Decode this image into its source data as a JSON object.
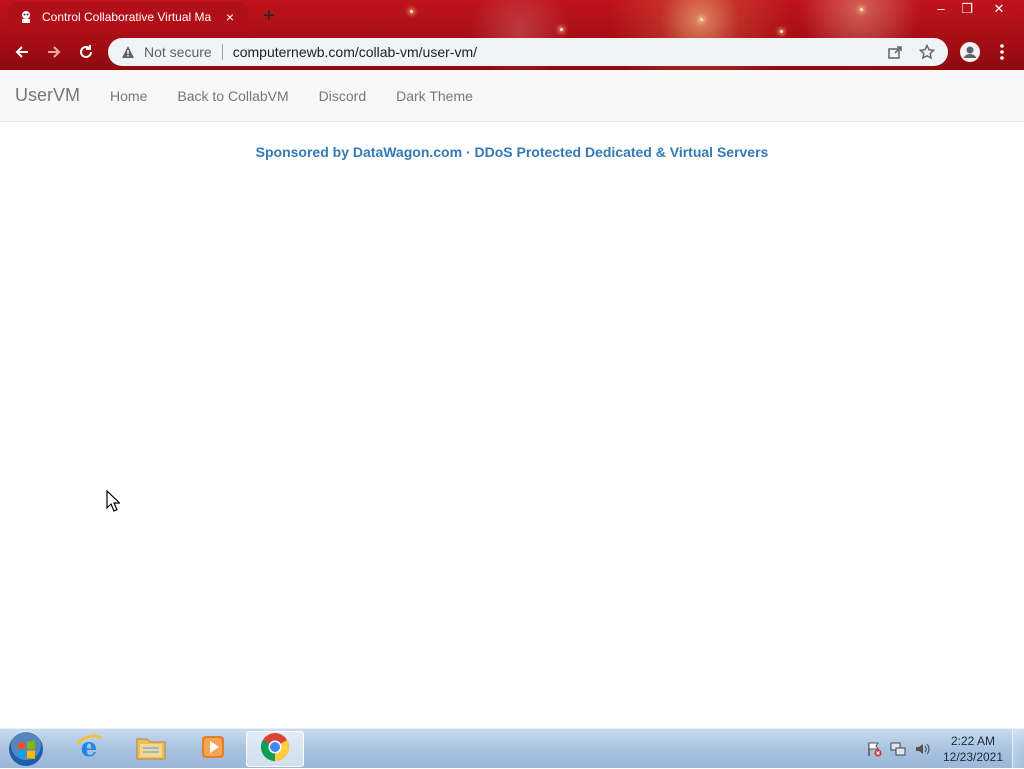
{
  "browser": {
    "tab": {
      "title": "Control Collaborative Virtual Ma",
      "close_glyph": "×"
    },
    "new_tab_glyph": "+",
    "window_controls": {
      "minimize_glyph": "–",
      "restore_glyph": "❐",
      "close_glyph": "✕"
    },
    "omnibox": {
      "security_label": "Not secure",
      "url": "computernewb.com/collab-vm/user-vm/"
    },
    "icons": {
      "back": "back-arrow-icon",
      "forward": "forward-arrow-icon",
      "reload": "reload-icon",
      "warning": "warning-triangle-icon",
      "share": "share-icon",
      "bookmark": "star-icon",
      "profile": "profile-icon",
      "menu": "kebab-menu-icon"
    }
  },
  "navbar": {
    "brand": "UserVM",
    "links": [
      {
        "label": "Home"
      },
      {
        "label": "Back to CollabVM"
      },
      {
        "label": "Discord"
      },
      {
        "label": "Dark Theme"
      }
    ]
  },
  "sponsor": {
    "text": "Sponsored by DataWagon.com · DDoS Protected Dedicated & Virtual Servers"
  },
  "taskbar": {
    "apps": [
      {
        "name": "internet-explorer",
        "icon": "internet-explorer-icon"
      },
      {
        "name": "file-explorer",
        "icon": "folder-icon"
      },
      {
        "name": "media-player",
        "icon": "media-player-icon"
      },
      {
        "name": "chrome",
        "icon": "chrome-icon",
        "active": true
      }
    ],
    "clock": {
      "time": "2:22 AM",
      "date": "12/23/2021"
    }
  },
  "colors": {
    "chrome_red": "#b21018",
    "link_blue": "#337ab7",
    "nav_text": "#777777",
    "taskbar": "#a9c3e0"
  }
}
